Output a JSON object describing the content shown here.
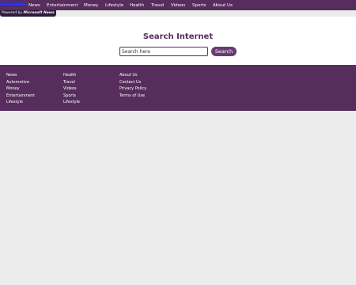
{
  "header": {
    "logo_alt": "Default Logo",
    "nav": [
      "News",
      "Entertainment",
      "Money",
      "Lifestyle",
      "Health",
      "Travel",
      "Videos",
      "Sports",
      "About Us"
    ],
    "powered_prefix": "Powered by",
    "powered_brand": "Microsoft News"
  },
  "search": {
    "title": "Search Internet",
    "placeholder": "Search here",
    "button_label": "Search"
  },
  "footer": {
    "columns": [
      [
        "News",
        "Automotive",
        "Money",
        "Entertainment",
        "Lifestyle"
      ],
      [
        "Health",
        "Travel",
        "Videos",
        "Sports",
        "Lifestyle"
      ],
      [
        "About Us",
        "Contact Us",
        "Privacy Policy",
        "Terms of Use"
      ]
    ]
  },
  "colors": {
    "brand": "#562d5c",
    "page_background": "#ececec",
    "button": "#6a3a72"
  }
}
